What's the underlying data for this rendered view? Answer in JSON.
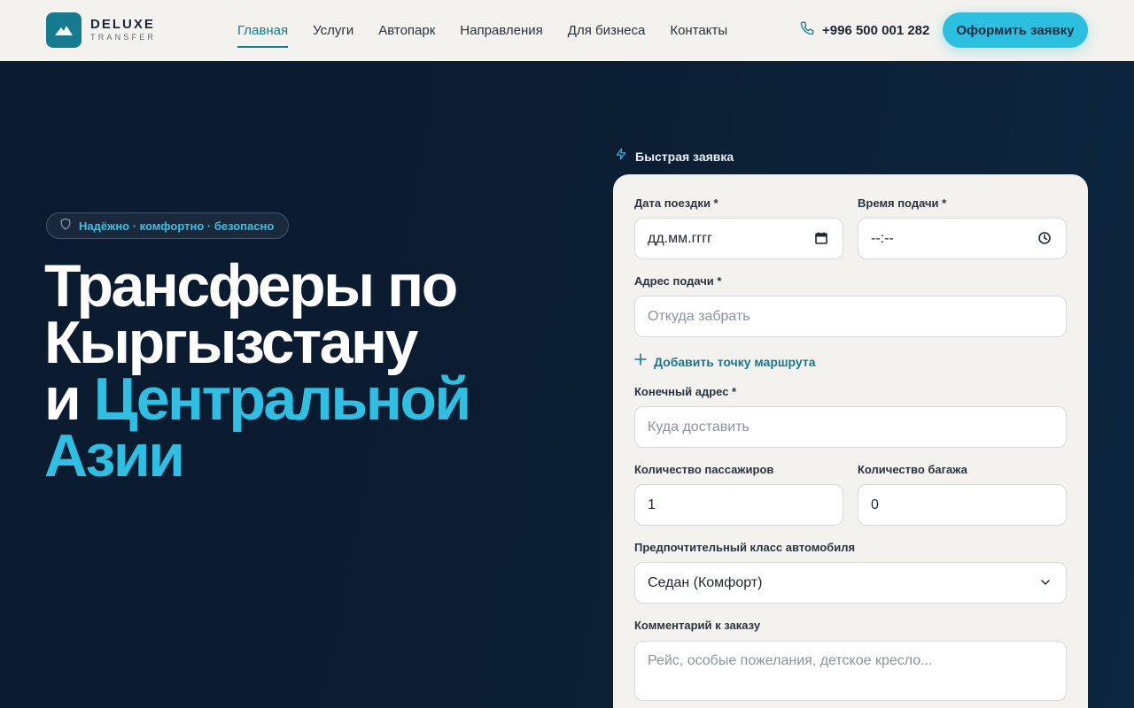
{
  "header": {
    "logo": {
      "title": "DELUXE",
      "subtitle": "TRANSFER"
    },
    "nav": [
      {
        "label": "Главная",
        "active": true
      },
      {
        "label": "Услуги",
        "active": false
      },
      {
        "label": "Автопарк",
        "active": false
      },
      {
        "label": "Направления",
        "active": false
      },
      {
        "label": "Для бизнеса",
        "active": false
      },
      {
        "label": "Контакты",
        "active": false
      }
    ],
    "phone": "+996 500 001 282",
    "cta_label": "Оформить заявку"
  },
  "hero": {
    "badge": "Надёжно · комфортно · безопасно",
    "title_line1": "Трансферы по",
    "title_line2": "Кыргызстану",
    "title_line3_prefix": "и ",
    "title_accent_1": "Центральной",
    "title_accent_2": "Азии"
  },
  "form": {
    "heading": "Быстрая заявка",
    "date_label": "Дата поездки *",
    "date_value": "дд.мм.гггг",
    "time_label": "Время подачи *",
    "time_value": "--:--",
    "pickup_label": "Адрес подачи *",
    "pickup_placeholder": "Откуда забрать",
    "add_point_label": "Добавить точку маршрута",
    "destination_label": "Конечный адрес *",
    "destination_placeholder": "Куда доставить",
    "passengers_label": "Количество пассажиров",
    "passengers_value": "1",
    "luggage_label": "Количество багажа",
    "luggage_value": "0",
    "car_class_label": "Предпочтительный класс автомобиля",
    "car_class_value": "Седан (Комфорт)",
    "comment_label": "Комментарий к заказу",
    "comment_placeholder": "Рейс, особые пожелания, детское кресло..."
  },
  "colors": {
    "accent": "#2bbfe0",
    "brand": "#167b8e",
    "hero_bg": "#0b1b2f",
    "header_bg": "#f3f2ee"
  },
  "icons": [
    "mountain-logo-icon",
    "phone-icon",
    "shield-icon",
    "lightning-icon",
    "calendar-icon",
    "clock-icon",
    "plus-icon",
    "chevron-down-icon"
  ]
}
